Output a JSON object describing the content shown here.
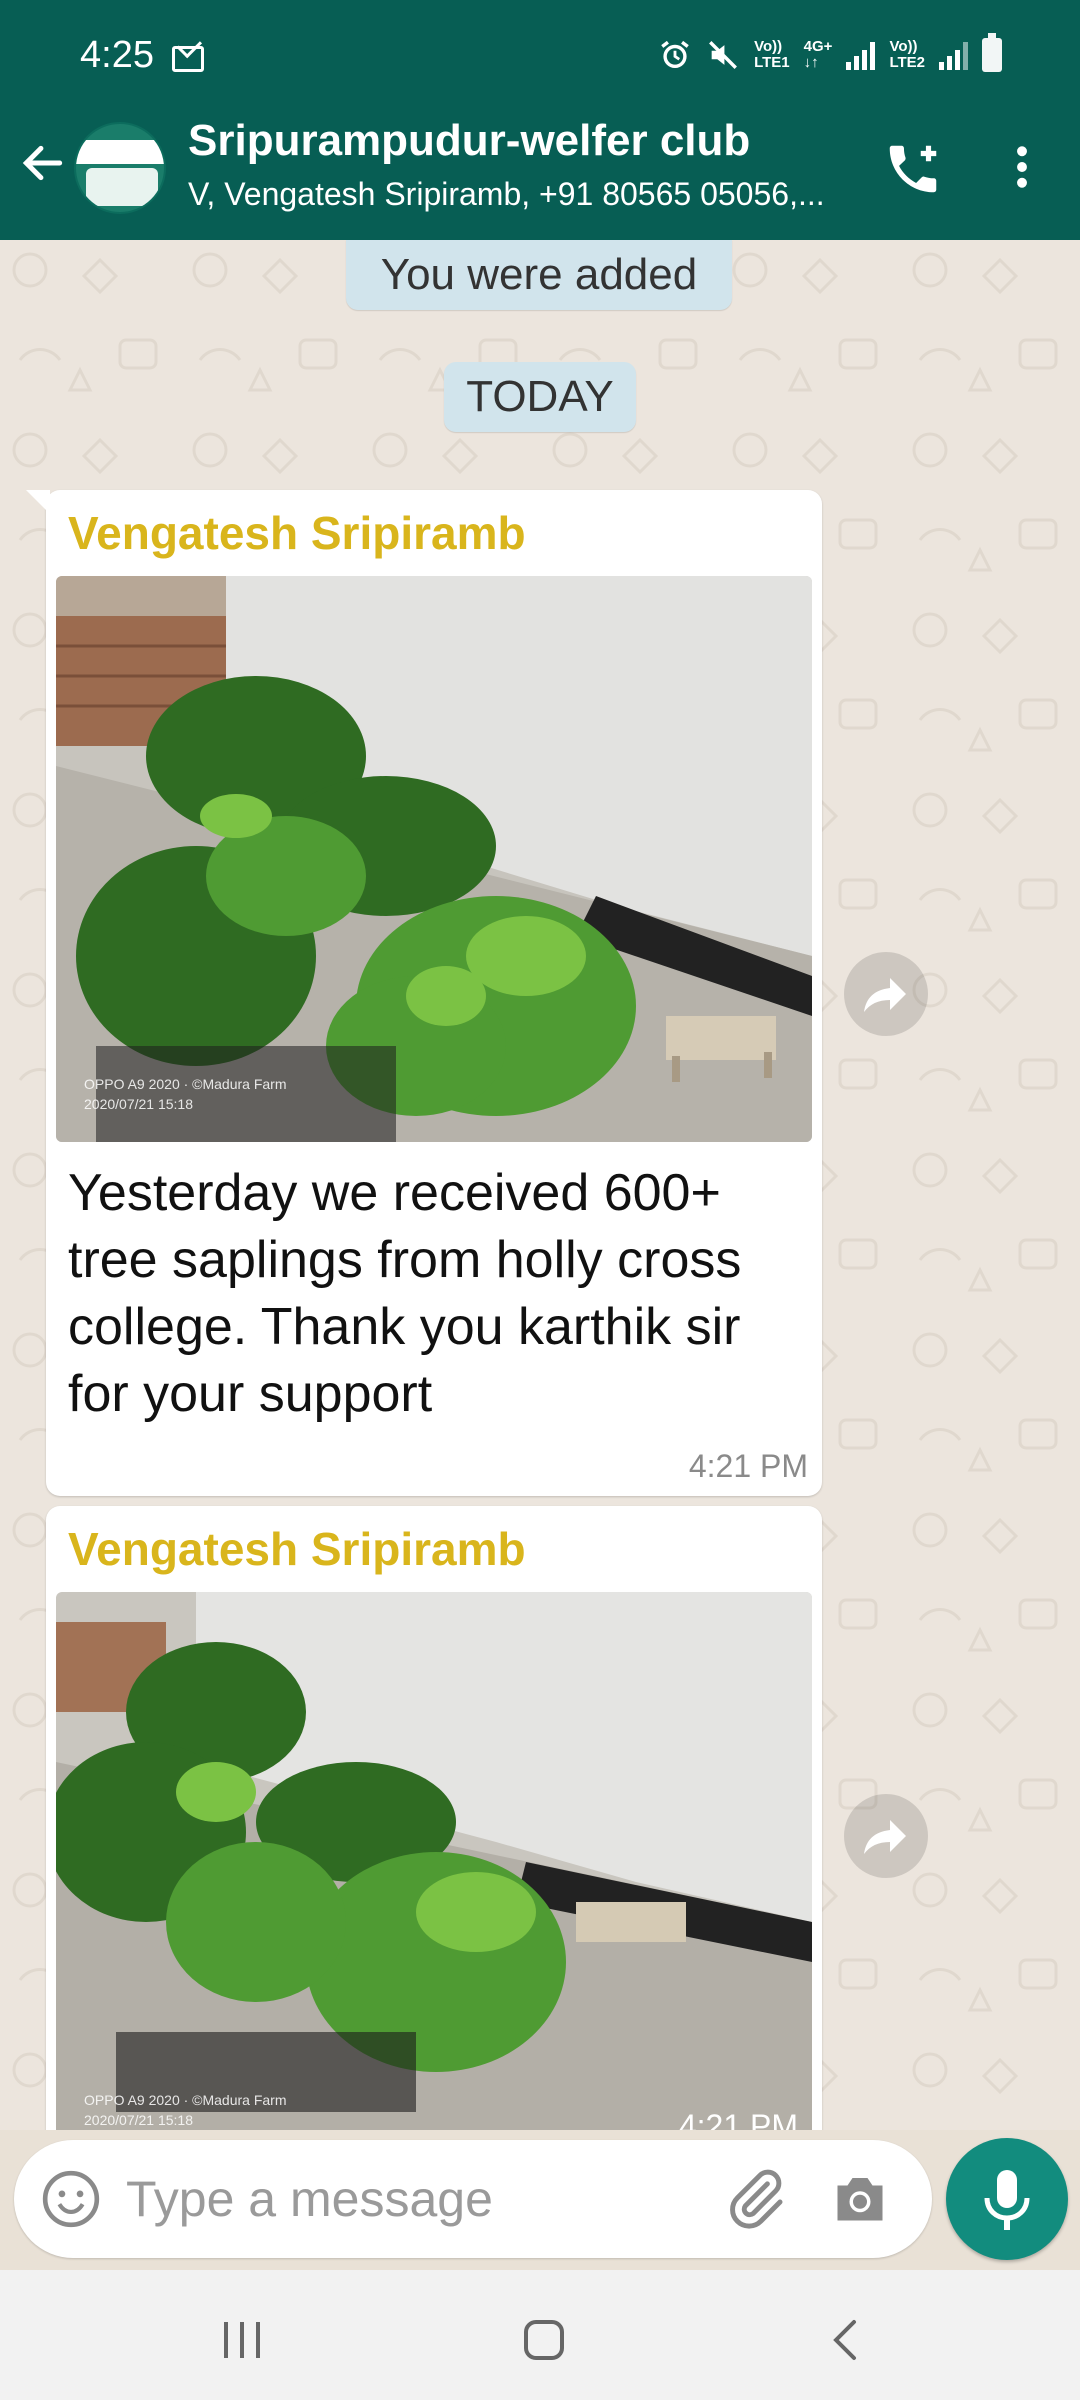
{
  "status_bar": {
    "time": "4:25",
    "sim1": {
      "top": "Vo))",
      "bottom": "LTE1"
    },
    "net": "4G+",
    "sim2": {
      "top": "Vo))",
      "bottom": "LTE2"
    }
  },
  "header": {
    "title": "Sripurampudur-welfer club",
    "subtitle": "V, Vengatesh Sripiramb, +91 80565 05056,..."
  },
  "system_messages": {
    "added": "You were added",
    "date": "TODAY"
  },
  "messages": [
    {
      "sender": "Vengatesh Sripiramb",
      "photo_watermark": {
        "device": "OPPO A9 2020 · ©Madura Farm",
        "date": "2020/07/21 15:18"
      },
      "text": "Yesterday we received 600+ tree saplings from holly cross college.  Thank you karthik sir for your support",
      "time": "4:21 PM"
    },
    {
      "sender": "Vengatesh Sripiramb",
      "photo_watermark": {
        "device": "OPPO A9 2020 · ©Madura Farm",
        "date": "2020/07/21 15:18"
      },
      "time": "4:21 PM"
    }
  ],
  "composer": {
    "placeholder": "Type a message"
  },
  "icons": {
    "back": "arrow-left",
    "call": "add-call",
    "menu": "more-vertical",
    "forward": "forward-arrow",
    "emoji": "smiley",
    "attach": "paperclip",
    "camera": "camera",
    "mic": "microphone"
  },
  "colors": {
    "header": "#075e54",
    "sender_name": "#d9b51c",
    "mic_button": "#128c7e",
    "chat_bg": "#ece5dd"
  }
}
